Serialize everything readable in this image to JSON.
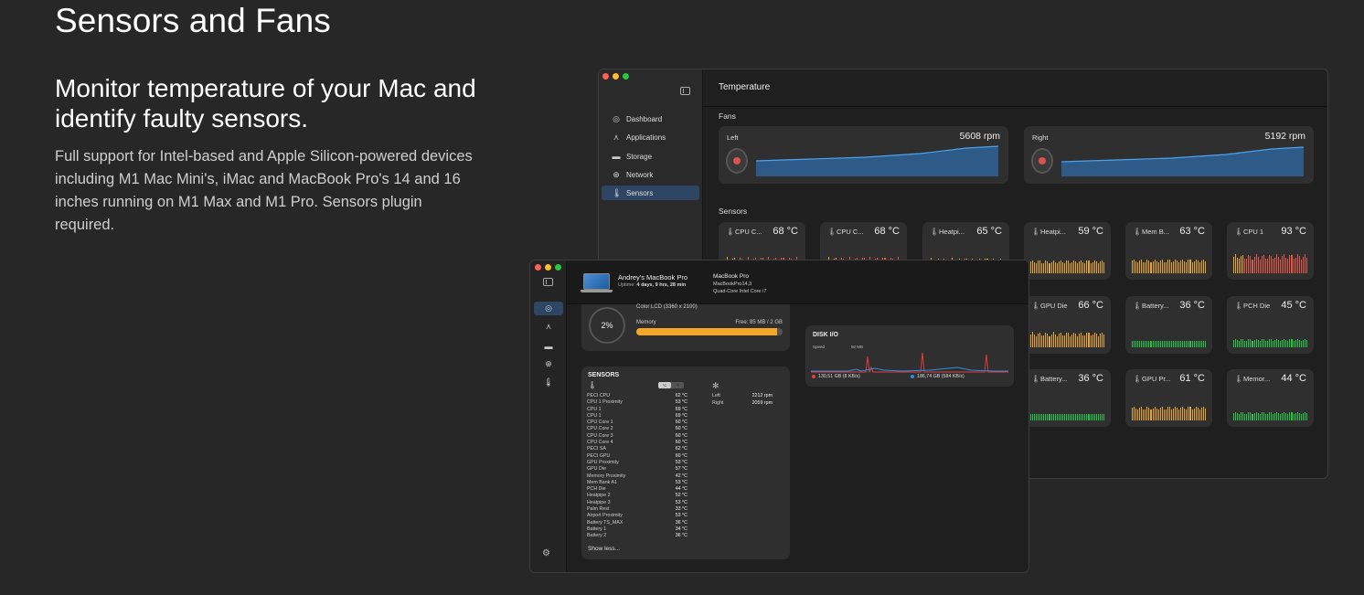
{
  "hero": {
    "title": "Sensors and Fans",
    "subtitle": "Monitor temperature of your Mac and identify faulty sensors.",
    "body": "Full support for Intel-based and Apple Silicon-powered devices including M1 Mac Mini's, iMac and MacBook Pro's 14 and 16 inches running on M1 Max and M1 Pro. Sensors plugin required."
  },
  "back_window": {
    "title": "Temperature",
    "nav": [
      {
        "label": "Dashboard",
        "icon": "gauge-icon"
      },
      {
        "label": "Applications",
        "icon": "apps-icon"
      },
      {
        "label": "Storage",
        "icon": "storage-icon"
      },
      {
        "label": "Network",
        "icon": "globe-icon"
      },
      {
        "label": "Sensors",
        "icon": "thermometer-icon",
        "active": true
      }
    ],
    "fans_label": "Fans",
    "fans": [
      {
        "name": "Left",
        "rpm": "5608 rpm"
      },
      {
        "name": "Right",
        "rpm": "5192 rpm"
      }
    ],
    "sensors_label": "Sensors",
    "sensors": [
      {
        "name": "CPU C...",
        "value": "68 °C",
        "level": 0.85
      },
      {
        "name": "CPU C...",
        "value": "68 °C",
        "level": 0.85
      },
      {
        "name": "Heatpi...",
        "value": "65 °C",
        "level": 0.8
      },
      {
        "name": "Heatpi...",
        "value": "59 °C",
        "level": 0.7
      },
      {
        "name": "Mem B...",
        "value": "63 °C",
        "level": 0.75
      },
      {
        "name": "CPU 1",
        "value": "93 °C",
        "level": 1.0
      },
      {
        "name": "GPU Die",
        "value": "66 °C",
        "level": 0.8
      },
      {
        "name": "Battery...",
        "value": "36 °C",
        "level": 0.35
      },
      {
        "name": "PCH Die",
        "value": "45 °C",
        "level": 0.45
      },
      {
        "name": "Battery...",
        "value": "36 °C",
        "level": 0.35
      },
      {
        "name": "GPU Pr...",
        "value": "61 °C",
        "level": 0.75
      },
      {
        "name": "Memor...",
        "value": "44 °C",
        "level": 0.45
      }
    ]
  },
  "front_window": {
    "device_name": "Andrey's MacBook Pro",
    "uptime_label": "Uptime:",
    "uptime_value": "4 days, 9 hrs, 28 min",
    "model": "MacBook Pro",
    "model_id": "MacBookPro14,3",
    "cpu": "Quad-Core Intel Core i7",
    "display": "Color LCD (3360 x 2100)",
    "gauge_value": "2%",
    "memory_label": "Memory",
    "memory_free": "Free: 85 MB / 2 GB",
    "memory_used_fraction": 0.96,
    "sensors_title": "SENSORS",
    "unit_c": "°C",
    "unit_f": "°F",
    "sensor_rows": [
      {
        "name": "PECI CPU",
        "value": "62 °C"
      },
      {
        "name": "CPU 1 Proximity",
        "value": "53 °C"
      },
      {
        "name": "CPU 1",
        "value": "69 °C"
      },
      {
        "name": "CPU 1",
        "value": "69 °C"
      },
      {
        "name": "CPU Core 1",
        "value": "60 °C"
      },
      {
        "name": "CPU Core 2",
        "value": "60 °C"
      },
      {
        "name": "CPU Core 3",
        "value": "60 °C"
      },
      {
        "name": "CPU Core 4",
        "value": "60 °C"
      },
      {
        "name": "PECI SA",
        "value": "62 °C"
      },
      {
        "name": "PECI GPU",
        "value": "60 °C"
      },
      {
        "name": "GPU Proximity",
        "value": "53 °C"
      },
      {
        "name": "GPU Die",
        "value": "57 °C"
      },
      {
        "name": "Memory Proximity",
        "value": "42 °C"
      },
      {
        "name": "Mem Bank A1",
        "value": "53 °C"
      },
      {
        "name": "PCH Die",
        "value": "44 °C"
      },
      {
        "name": "Heatpipe 2",
        "value": "52 °C"
      },
      {
        "name": "Heatpipe 3",
        "value": "53 °C"
      },
      {
        "name": "Palm Rest",
        "value": "33 °C"
      },
      {
        "name": "Airport Proximity",
        "value": "53 °C"
      },
      {
        "name": "Battery TS_MAX",
        "value": "36 °C"
      },
      {
        "name": "Battery 1",
        "value": "34 °C"
      },
      {
        "name": "Battery 2",
        "value": "36 °C"
      }
    ],
    "fan_rows": [
      {
        "name": "Left",
        "value": "2212 rpm"
      },
      {
        "name": "Right",
        "value": "2059 rpm"
      }
    ],
    "show_less": "Show less...",
    "disk_title": "DISK I/O",
    "disk_speed": "Speed",
    "disk_scale": "50 MB",
    "disk_read": "130,51 GB (8 KB/s)",
    "disk_write": "186,74 GB (584 KB/s)",
    "colors": {
      "read": "#e03c3c",
      "write": "#2f8ee6"
    }
  }
}
